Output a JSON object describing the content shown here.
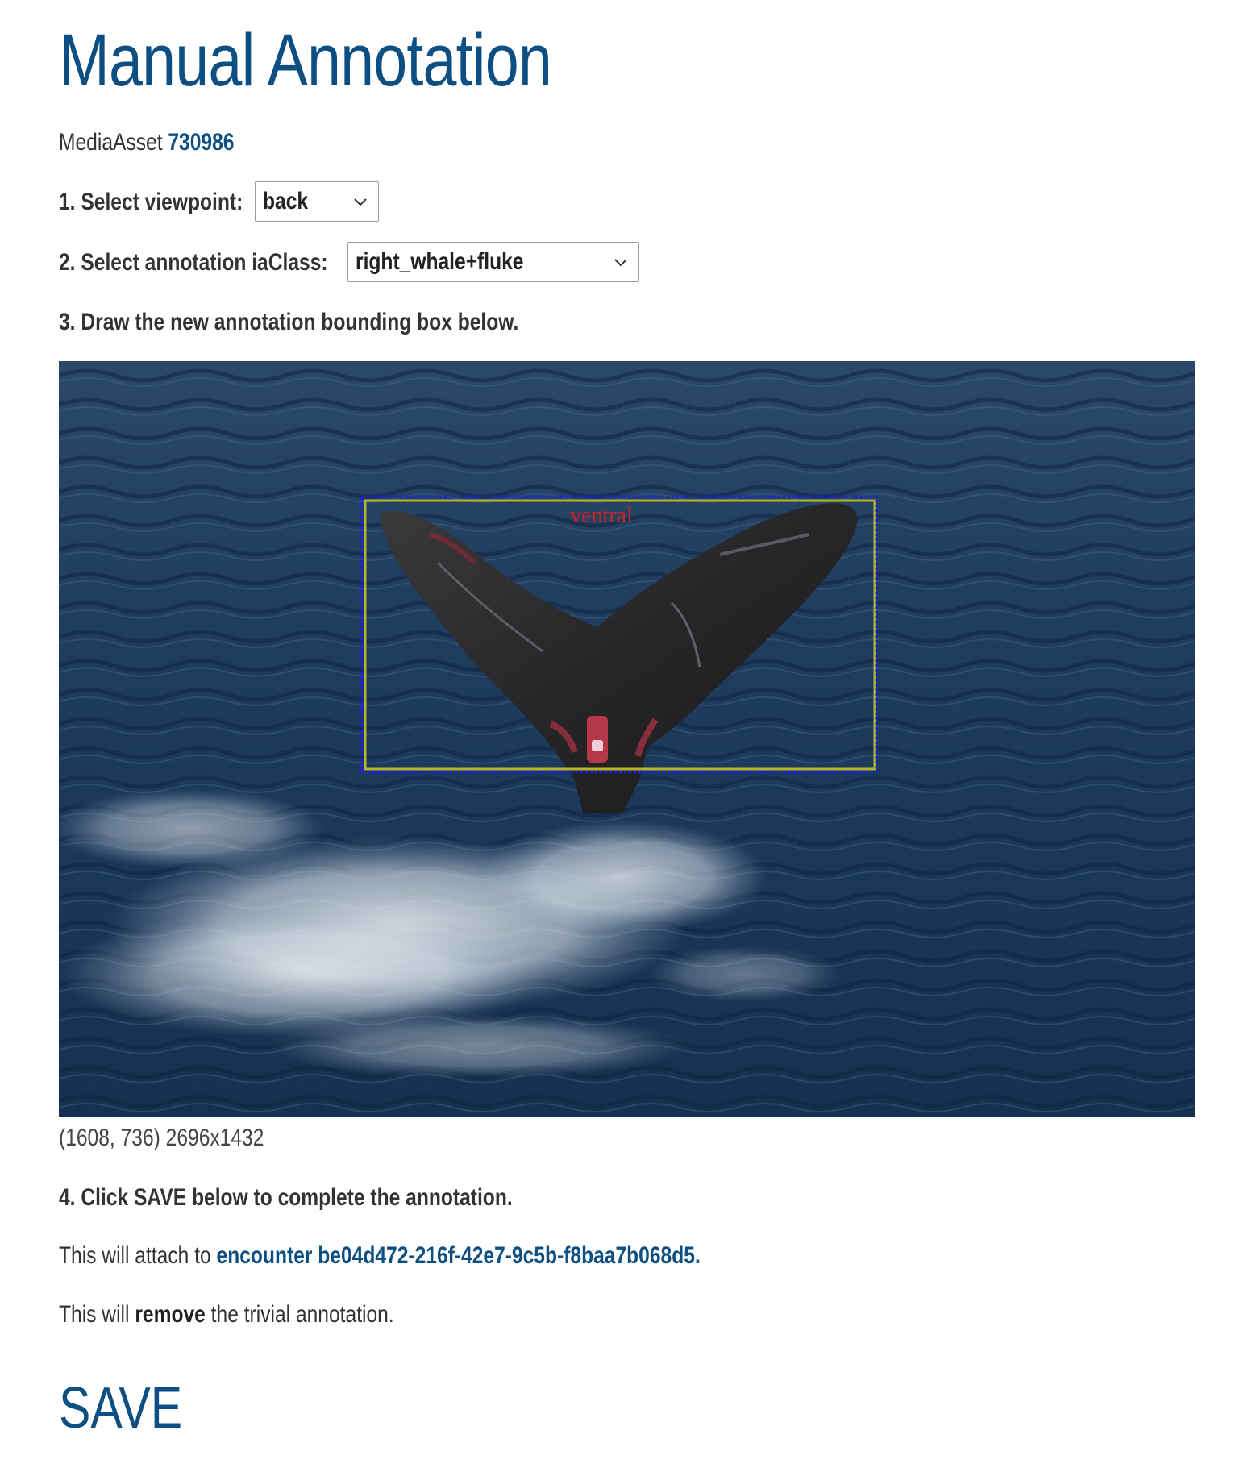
{
  "page": {
    "title": "Manual Annotation"
  },
  "media_asset": {
    "label": "MediaAsset",
    "id": "730986"
  },
  "steps": {
    "step1_label": "1. Select viewpoint:",
    "step2_label": "2. Select annotation iaClass:",
    "step3_label": "3. Draw the new annotation bounding box below.",
    "step4_label": "4. Click SAVE below to complete the annotation."
  },
  "viewpoint_select": {
    "selected": "back"
  },
  "iaclass_select": {
    "selected": "right_whale+fluke"
  },
  "annotation": {
    "existing_label": "ventral",
    "coords_text": "(1608, 736) 2696x1432",
    "box_colors": {
      "existing": "#b5b52a",
      "new": "#1a1aff",
      "label": "#cc2222"
    }
  },
  "attach": {
    "prefix": "This will attach to",
    "link_text": "encounter be04d472-216f-42e7-9c5b-f8baa7b068d5",
    "suffix": "."
  },
  "remove": {
    "prefix": "This will",
    "bold": "remove",
    "suffix": "the trivial annotation."
  },
  "save": {
    "label": "SAVE"
  },
  "colors": {
    "accent": "#0d4f82",
    "text": "#333333"
  },
  "icons": {
    "select_chevron": "chevron-down-icon"
  }
}
